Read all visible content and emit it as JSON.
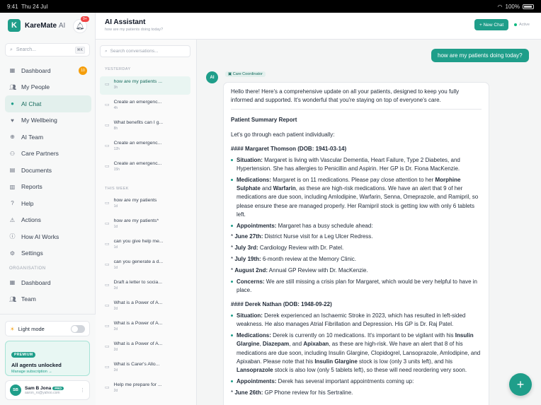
{
  "statusbar": {
    "time": "9:41",
    "date": "Thu 24 Jul",
    "battery": "100%"
  },
  "brand": {
    "name": "KareMate",
    "suffix": "AI",
    "logo_letter": "K"
  },
  "notifications": {
    "count": "9+"
  },
  "search": {
    "placeholder": "Search...",
    "shortcut": "⌘K"
  },
  "nav": [
    {
      "label": "Dashboard",
      "icon": "grid-icon",
      "badge": "10"
    },
    {
      "label": "My People",
      "icon": "people-icon"
    },
    {
      "label": "AI Chat",
      "icon": "chat-icon",
      "active": true
    },
    {
      "label": "My Wellbeing",
      "icon": "heart-icon"
    },
    {
      "label": "AI Team",
      "icon": "team-icon"
    },
    {
      "label": "Care Partners",
      "icon": "partners-icon"
    },
    {
      "label": "Documents",
      "icon": "document-icon"
    },
    {
      "label": "Reports",
      "icon": "report-icon"
    },
    {
      "label": "Help",
      "icon": "help-icon"
    },
    {
      "label": "Actions",
      "icon": "alert-icon"
    },
    {
      "label": "How AI Works",
      "icon": "info-icon"
    },
    {
      "label": "Settings",
      "icon": "gear-icon"
    }
  ],
  "org_section": "ORGANISATION",
  "org_nav": [
    {
      "label": "Dashboard",
      "icon": "grid-icon"
    },
    {
      "label": "Team",
      "icon": "people-icon"
    }
  ],
  "light_mode": {
    "label": "Light mode"
  },
  "premium": {
    "pill": "PREMIUM",
    "title": "All agents unlocked",
    "link": "Manage subscription →"
  },
  "user": {
    "initials": "SB",
    "name": "Sam B Jona",
    "pro": "PRO",
    "email": "aaron_ro@yahoo.com"
  },
  "header": {
    "title": "AI Assistant",
    "subtitle": "how are my patients doing today?",
    "new_chat": "+ New Chat",
    "status": "Active"
  },
  "conversations": {
    "search_placeholder": "Search conversations...",
    "yesterday_label": "YESTERDAY",
    "this_week_label": "THIS WEEK",
    "yesterday": [
      {
        "title": "how are my patients ...",
        "time": "3h",
        "selected": true
      },
      {
        "title": "Create an emergenc...",
        "time": "4h"
      },
      {
        "title": "What benefits can I g...",
        "time": "8h"
      },
      {
        "title": "Create an emergenc...",
        "time": "12h"
      },
      {
        "title": "Create an emergenc...",
        "time": "15h"
      }
    ],
    "this_week": [
      {
        "title": "how are my patients",
        "time": "1d"
      },
      {
        "title": "how are my patients*",
        "time": "1d"
      },
      {
        "title": "can you give help me...",
        "time": "1d"
      },
      {
        "title": "can you generate a d...",
        "time": "1d"
      },
      {
        "title": "Draft a letter to socia...",
        "time": "2d"
      },
      {
        "title": "What is a Power of A...",
        "time": "2d"
      },
      {
        "title": "What is a Power of A...",
        "time": "2d"
      },
      {
        "title": "What is a Power of A...",
        "time": "2d"
      },
      {
        "title": "What is Carer's Allo...",
        "time": "2d"
      },
      {
        "title": "Help me prepare for ...",
        "time": "2d"
      }
    ]
  },
  "chat": {
    "user_message": "how are my patients doing today?",
    "ai_avatar": "AI",
    "role": "Care Coordinator",
    "intro": "Hello there! Here's a comprehensive update on all your patients, designed to keep you fully informed and supported. It's wonderful that you're staying on top of everyone's care.",
    "summary_title": "Patient Summary Report",
    "lead": "Let's go through each patient individually:",
    "p1": {
      "heading": "#### Margaret Thomson (DOB: 1941-03-14)",
      "situation_label": "Situation:",
      "situation": "Margaret is living with Vascular Dementia, Heart Failure, Type 2 Diabetes, and Hypertension. She has allergies to Penicillin and Aspirin. Her GP is Dr. Fiona MacKenzie.",
      "med_label": "Medications:",
      "med_a": "Margaret is on 11 medications. Please pay close attention to her",
      "med_b1": "Morphine Sulphate",
      "med_and": "and",
      "med_b2": "Warfarin",
      "med_c": ", as these are high-risk medications. We have an alert that 9 of her medications are due soon, including Amlodipine, Warfarin, Senna, Omeprazole, and Ramipril, so please ensure these are managed properly. Her Ramipril stock is getting low with only 6 tablets left.",
      "appt_label": "Appointments:",
      "appt": "Margaret has a busy schedule ahead:",
      "a1_date": "June 27th:",
      "a1": "District Nurse visit for a Leg Ulcer Redress.",
      "a2_date": "July 3rd:",
      "a2": "Cardiology Review with Dr. Patel.",
      "a3_date": "July 19th:",
      "a3": "6-month review at the Memory Clinic.",
      "a4_date": "August 2nd:",
      "a4": "Annual GP Review with Dr. MacKenzie.",
      "concern_label": "Concerns:",
      "concern": "We are still missing a crisis plan for Margaret, which would be very helpful to have in place."
    },
    "p2": {
      "heading": "#### Derek Nathan (DOB: 1948-09-22)",
      "situation_label": "Situation:",
      "situation": "Derek experienced an Ischaemic Stroke in 2023, which has resulted in left-sided weakness. He also manages Atrial Fibrillation and Depression. His GP is Dr. Raj Patel.",
      "med_label": "Medications:",
      "med_a": "Derek is currently on 10 medications. It's important to be vigilant with his",
      "med_b1": "Insulin Glargine",
      "med_b2": "Diazepam",
      "med_and": "and",
      "med_b3": "Apixaban",
      "med_c": ", as these are high-risk. We have an alert that 8 of his medications are due soon, including Insulin Glargine, Clopidogrel, Lansoprazole, Amlodipine, and Apixaban. Please note that his",
      "med_b4": "Insulin Glargine",
      "med_d": "stock is low (only 3 units left), and his",
      "med_b5": "Lansoprazole",
      "med_e": "stock is also low (only 5 tablets left), so these will need reordering very soon.",
      "appt_label": "Appointments:",
      "appt": "Derek has several important appointments coming up:",
      "a1_date": "June 26th:",
      "a1": "GP Phone review for his Sertraline."
    }
  },
  "colors": {
    "accent": "#1f9e8a",
    "accent_light": "#e3f0ed",
    "badge": "#f59e0b",
    "alert": "#ef4444"
  }
}
